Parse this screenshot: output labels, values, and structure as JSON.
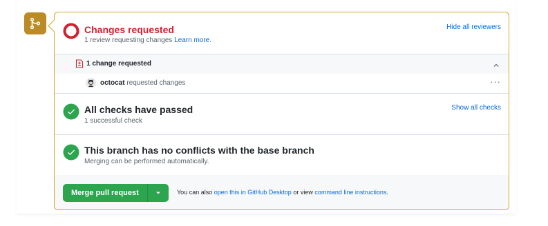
{
  "reviews": {
    "title": "Changes requested",
    "subtitle_prefix": "1 review requesting changes",
    "learn_more": "Learn more.",
    "hide_reviewers": "Hide all reviewers"
  },
  "changes": {
    "header": "1 change requested",
    "reviewer_name": "octocat",
    "reviewer_action": "requested changes",
    "more_label": "···"
  },
  "checks": {
    "title": "All checks have passed",
    "subtitle": "1 successful check",
    "show_all": "Show all checks"
  },
  "conflicts": {
    "title": "This branch has no conflicts with the base branch",
    "subtitle": "Merging can be performed automatically."
  },
  "merge": {
    "button_label": "Merge pull request",
    "hint_prefix": "You can also",
    "desktop_link": "open this in GitHub Desktop",
    "hint_middle": "or view",
    "cli_link": "command line instructions",
    "hint_suffix": "."
  },
  "colors": {
    "accent_merge_icon": "#bb8b26",
    "border_warning": "#d4a72c",
    "changes_requested_red": "#cf222e",
    "success_green": "#2da44e",
    "link_blue": "#0969da"
  },
  "icons": {
    "merge": "git-merge-icon",
    "changes": "x-circle-icon",
    "file_diff": "file-diff-icon",
    "check": "check-circle-icon",
    "chevron": "chevron-up-icon",
    "caret": "triangle-down-icon"
  }
}
